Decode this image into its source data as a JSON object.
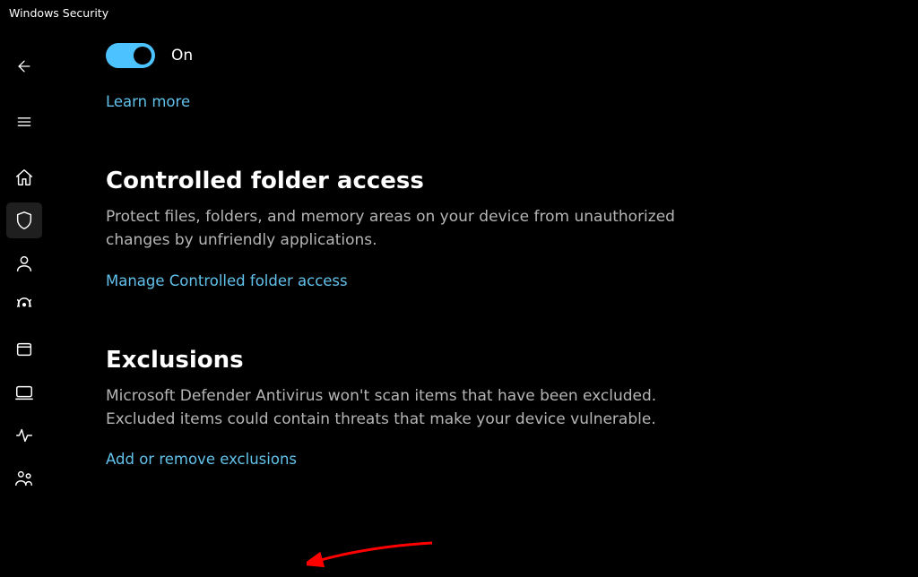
{
  "window": {
    "title": "Windows Security"
  },
  "sidebar": {
    "items": [
      {
        "name": "back"
      },
      {
        "name": "menu"
      },
      {
        "name": "home"
      },
      {
        "name": "shield",
        "selected": true
      },
      {
        "name": "account"
      },
      {
        "name": "firewall"
      },
      {
        "name": "app-browser"
      },
      {
        "name": "device-security"
      },
      {
        "name": "performance"
      },
      {
        "name": "family"
      }
    ]
  },
  "toggle": {
    "state": "on",
    "label": "On"
  },
  "links": {
    "learn_more": "Learn more",
    "manage_cfa": "Manage Controlled folder access",
    "add_exclusions": "Add or remove exclusions"
  },
  "sections": {
    "cfa": {
      "title": "Controlled folder access",
      "desc": "Protect files, folders, and memory areas on your device from unauthorized changes by unfriendly applications."
    },
    "exclusions": {
      "title": "Exclusions",
      "desc": "Microsoft Defender Antivirus won't scan items that have been excluded. Excluded items could contain threats that make your device vulnerable."
    }
  },
  "colors": {
    "link": "#61c1ea",
    "accent": "#4cc2ff",
    "desc": "#b6b6b6",
    "arrow": "#ff0000"
  }
}
